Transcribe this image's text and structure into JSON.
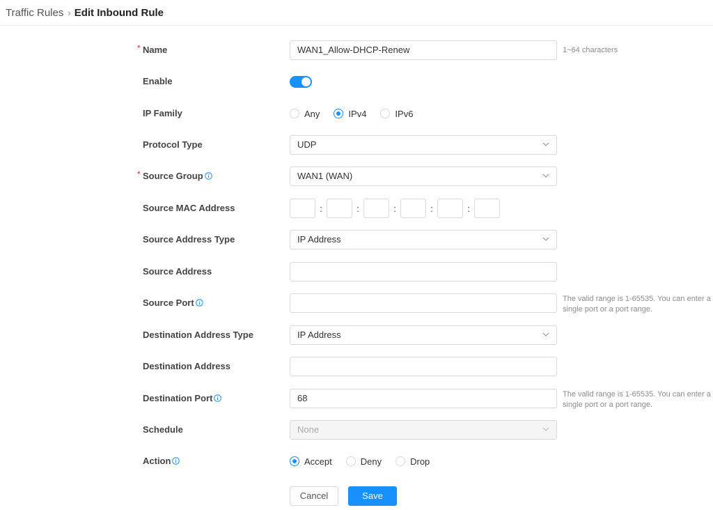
{
  "breadcrumb": {
    "parent": "Traffic Rules",
    "separator": "›",
    "current": "Edit Inbound Rule"
  },
  "form": {
    "name": {
      "label": "Name",
      "required": "*",
      "value": "WAN1_Allow-DHCP-Renew",
      "hint": "1~64 characters"
    },
    "enable": {
      "label": "Enable",
      "checked": true
    },
    "ip_family": {
      "label": "IP Family",
      "options": [
        "Any",
        "IPv4",
        "IPv6"
      ],
      "selected": "IPv4"
    },
    "protocol_type": {
      "label": "Protocol Type",
      "value": "UDP"
    },
    "source_group": {
      "label": "Source Group",
      "required": "*",
      "value": "WAN1 (WAN)"
    },
    "source_mac": {
      "label": "Source MAC Address",
      "separator": ":",
      "octets": [
        "",
        "",
        "",
        "",
        "",
        ""
      ]
    },
    "source_address_type": {
      "label": "Source Address Type",
      "value": "IP Address"
    },
    "source_address": {
      "label": "Source Address",
      "value": ""
    },
    "source_port": {
      "label": "Source Port",
      "value": "",
      "hint": "The valid range is 1-65535. You can enter a single port or a port range."
    },
    "destination_address_type": {
      "label": "Destination Address Type",
      "value": "IP Address"
    },
    "destination_address": {
      "label": "Destination Address",
      "value": ""
    },
    "destination_port": {
      "label": "Destination Port",
      "value": "68",
      "hint": "The valid range is 1-65535. You can enter a single port or a port range."
    },
    "schedule": {
      "label": "Schedule",
      "value": "None",
      "disabled": true
    },
    "action": {
      "label": "Action",
      "options": [
        "Accept",
        "Deny",
        "Drop"
      ],
      "selected": "Accept"
    }
  },
  "buttons": {
    "cancel": "Cancel",
    "save": "Save"
  },
  "colors": {
    "accent": "#1890ff",
    "required": "#f5222d",
    "border": "#d9d9d9",
    "hint": "#8c8c8c"
  },
  "icons": {
    "info": "info-circle-icon",
    "dropdown": "chevron-down-icon",
    "breadcrumb_separator": "chevron-right-icon"
  }
}
